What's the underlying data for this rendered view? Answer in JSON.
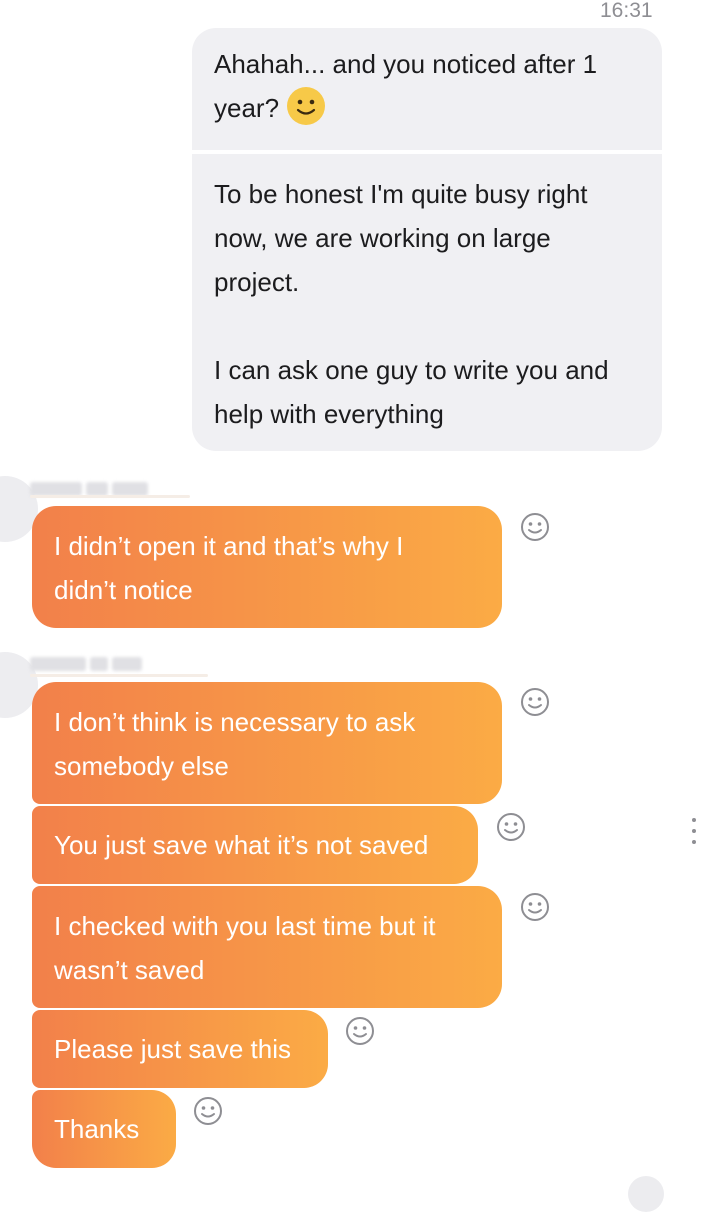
{
  "chat": {
    "timestamp": "16:31",
    "outgoing": [
      {
        "lines": [
          "Ahahah... and you noticed after 1",
          "year?"
        ],
        "emoji": "smiley-emoji"
      },
      {
        "lines": [
          "To be honest I'm quite busy right",
          "now, we are working on large",
          "project.",
          "",
          "I can ask one guy to write you and",
          "help with everything"
        ]
      }
    ],
    "incoming_groups": [
      {
        "sender_name_hidden": true,
        "messages": [
          {
            "lines": [
              "I didn’t open it and that’s why I",
              "didn’t notice"
            ]
          }
        ]
      },
      {
        "sender_name_hidden": true,
        "messages": [
          {
            "lines": [
              "I don’t think is necessary to ask",
              "somebody else"
            ]
          },
          {
            "lines": [
              "You just save what it’s not saved"
            ]
          },
          {
            "lines": [
              "I checked with you last time but it",
              "wasn’t saved"
            ]
          },
          {
            "lines": [
              "Please just save this"
            ]
          },
          {
            "lines": [
              "Thanks"
            ]
          }
        ]
      }
    ]
  },
  "icons": {
    "reaction": "smiley-reaction-icon",
    "more": "more-vertical-icon"
  },
  "colors": {
    "outgoing_bubble": "#f0f0f3",
    "incoming_gradient_start": "#f2804a",
    "incoming_gradient_end": "#fbab45",
    "timestamp": "#8e8e93"
  }
}
